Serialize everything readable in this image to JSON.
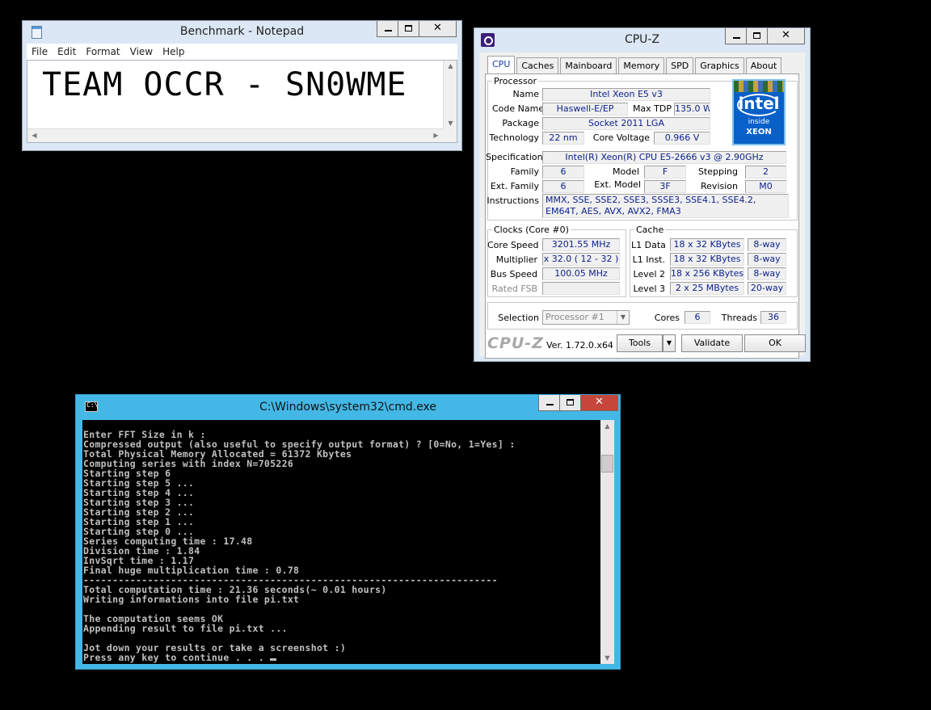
{
  "notepad": {
    "title": "Benchmark - Notepad",
    "menu": [
      "File",
      "Edit",
      "Format",
      "View",
      "Help"
    ],
    "text": "TEAM OCCR - SN0WME"
  },
  "cpuz": {
    "title": "CPU-Z",
    "tabs": [
      "CPU",
      "Caches",
      "Mainboard",
      "Memory",
      "SPD",
      "Graphics",
      "About"
    ],
    "active_tab": "CPU",
    "processor": {
      "legend": "Processor",
      "name_label": "Name",
      "name": "Intel Xeon E5 v3",
      "codename_label": "Code Name",
      "codename": "Haswell-E/EP",
      "maxtdp_label": "Max TDP",
      "maxtdp": "135.0 W",
      "package_label": "Package",
      "package": "Socket 2011 LGA",
      "technology_label": "Technology",
      "technology": "22 nm",
      "corevoltage_label": "Core Voltage",
      "corevoltage": "0.966 V",
      "specification_label": "Specification",
      "specification": "Intel(R) Xeon(R) CPU E5-2666 v3 @ 2.90GHz",
      "family_label": "Family",
      "family": "6",
      "model_label": "Model",
      "model": "F",
      "stepping_label": "Stepping",
      "stepping": "2",
      "extfamily_label": "Ext. Family",
      "extfamily": "6",
      "extmodel_label": "Ext. Model",
      "extmodel": "3F",
      "revision_label": "Revision",
      "revision": "M0",
      "instructions_label": "Instructions",
      "instructions": "MMX, SSE, SSE2, SSE3, SSSE3, SSE4.1, SSE4.2, EM64T, AES, AVX, AVX2, FMA3",
      "logo": {
        "line1": "intel",
        "line2": "inside",
        "line3": "XEON"
      }
    },
    "clocks": {
      "legend": "Clocks (Core #0)",
      "corespeed_label": "Core Speed",
      "corespeed": "3201.55 MHz",
      "multiplier_label": "Multiplier",
      "multiplier": "x 32.0 ( 12 - 32 )",
      "busspeed_label": "Bus Speed",
      "busspeed": "100.05 MHz",
      "ratedfsb_label": "Rated FSB",
      "ratedfsb": ""
    },
    "cache": {
      "legend": "Cache",
      "rows": [
        {
          "label": "L1 Data",
          "size": "18 x 32 KBytes",
          "way": "8-way"
        },
        {
          "label": "L1 Inst.",
          "size": "18 x 32 KBytes",
          "way": "8-way"
        },
        {
          "label": "Level 2",
          "size": "18 x 256 KBytes",
          "way": "8-way"
        },
        {
          "label": "Level 3",
          "size": "2 x 25 MBytes",
          "way": "20-way"
        }
      ]
    },
    "selection_label": "Selection",
    "selection": "Processor #1",
    "cores_label": "Cores",
    "cores": "6",
    "threads_label": "Threads",
    "threads": "36",
    "brand": "CPU-Z",
    "version": "Ver. 1.72.0.x64",
    "tools_label": "Tools",
    "validate_label": "Validate",
    "ok_label": "OK"
  },
  "cmd": {
    "title": "C:\\Windows\\system32\\cmd.exe",
    "icon_text": "C:\\",
    "lines": [
      "Enter FFT Size in k :",
      "Compressed output (also useful to specify output format) ? [0=No, 1=Yes] :",
      "Total Physical Memory Allocated = 61372 Kbytes",
      "Computing series with index N=705226",
      "Starting step 6",
      "Starting step 5 ...",
      "Starting step 4 ...",
      "Starting step 3 ...",
      "Starting step 2 ...",
      "Starting step 1 ...",
      "Starting step 0 ...",
      "Series computing time : 17.48",
      "Division time : 1.84",
      "InvSqrt time : 1.17",
      "Final huge multiplication time : 0.78",
      "-----------------------------------------------------------------------",
      "Total computation time : 21.36 seconds(~ 0.01 hours)",
      "Writing informations into file pi.txt",
      "",
      "The computation seems OK",
      "Appending result to file pi.txt ...",
      "",
      "Jot down your results or take a screenshot :)",
      "Press any key to continue . . . "
    ]
  }
}
